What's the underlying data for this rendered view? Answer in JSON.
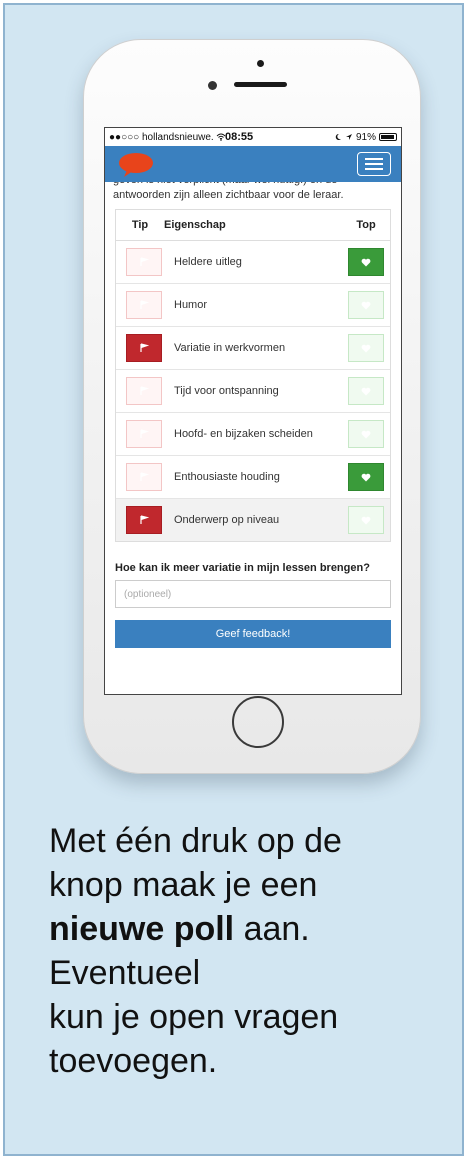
{
  "statusbar": {
    "carrier": "●●○○○ hollandsnieuwe.",
    "time": "08:55",
    "battery": "91%"
  },
  "intro": "geven is niet verplicht (maar wel nuttig!) en de antwoorden zijn alleen zichtbaar voor de leraar.",
  "table": {
    "headers": {
      "tip": "Tip",
      "eigenschap": "Eigenschap",
      "top": "Top"
    },
    "rows": [
      {
        "label": "Heldere uitleg",
        "tip": false,
        "top": true
      },
      {
        "label": "Humor",
        "tip": false,
        "top": false
      },
      {
        "label": "Variatie in werkvormen",
        "tip": true,
        "top": false
      },
      {
        "label": "Tijd voor ontspanning",
        "tip": false,
        "top": false
      },
      {
        "label": "Hoofd- en bijzaken scheiden",
        "tip": false,
        "top": false
      },
      {
        "label": "Enthousiaste houding",
        "tip": false,
        "top": true
      },
      {
        "label": "Onderwerp op niveau",
        "tip": true,
        "top": false
      }
    ]
  },
  "question": "Hoe kan ik meer variatie in mijn lessen brengen?",
  "input": {
    "placeholder": "(optioneel)"
  },
  "submit_label": "Geef feedback!",
  "caption": {
    "line1": "Met één druk op de",
    "line2": "knop maak je een",
    "bold": "nieuwe poll",
    "after_bold": " aan.",
    "line4": "Eventueel",
    "line5": "kun je open vragen",
    "line6": "toevoegen."
  },
  "colors": {
    "brand_blue": "#3a80bf",
    "tip_red": "#c0282d",
    "top_green": "#3a9b3a",
    "card_bg": "#d2e6f2"
  },
  "icons": [
    "flag-icon",
    "heart-icon",
    "chat-bubble-logo-icon",
    "hamburger-menu-icon",
    "wifi-icon",
    "location-icon"
  ]
}
